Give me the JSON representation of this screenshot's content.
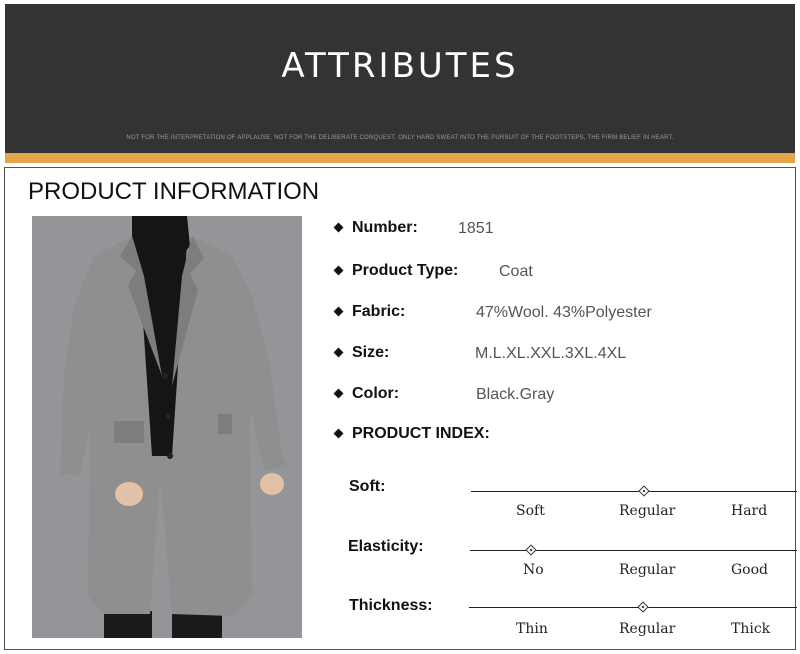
{
  "banner": {
    "title": "ATTRIBUTES",
    "subtitle": "NOT FOR THE INTERPRETATION OF APPLAUSE, NOT FOR THE DELIBERATE CONQUEST, ONLY HARD SWEAT INTO THE PURSUIT OF THE FOOTSTEPS, THE FIRM BELIEF IN HEART."
  },
  "section_title": "PRODUCT INFORMATION",
  "attributes": [
    {
      "label": "Number:",
      "value": "1851"
    },
    {
      "label": "Product Type:",
      "value": "Coat"
    },
    {
      "label": "Fabric:",
      "value": "47%Wool. 43%Polyester"
    },
    {
      "label": "Size:",
      "value": "M.L.XL.XXL.3XL.4XL"
    },
    {
      "label": "Color:",
      "value": "Black.Gray"
    }
  ],
  "index_title": "PRODUCT INDEX:",
  "index": [
    {
      "label": "Soft:",
      "options": [
        "Soft",
        "Regular",
        "Hard"
      ],
      "selected": "Regular"
    },
    {
      "label": "Elasticity:",
      "options": [
        "No",
        "Regular",
        "Good"
      ],
      "selected": "No"
    },
    {
      "label": "Thickness:",
      "options": [
        "Thin",
        "Regular",
        "Thick"
      ],
      "selected": "Regular"
    }
  ],
  "colors": {
    "banner": "#333333",
    "accent_bar": "#e2a54b",
    "photo_background": "#939598",
    "coat": "#8f8f8f"
  }
}
